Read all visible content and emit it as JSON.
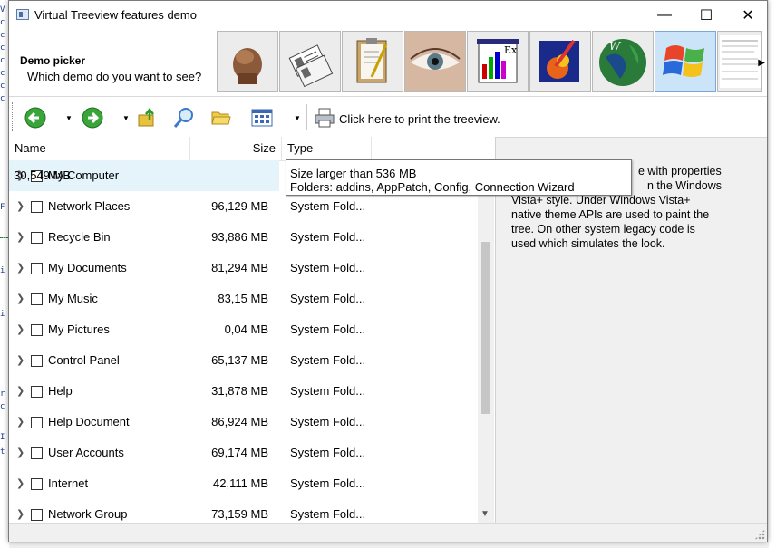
{
  "window": {
    "title": "Virtual Treeview features demo",
    "minimize": "—",
    "maximize": "☐",
    "close": "✕"
  },
  "picker": {
    "title": "Demo picker",
    "subtitle": "Which demo do you want to see?",
    "demos": [
      "speed-demo-icon",
      "properties-icon",
      "clipboard-icon",
      "eye-icon",
      "chart-icon",
      "paint-icon",
      "globe-icon",
      "windows-icon",
      "document-icon"
    ],
    "selected_index": 7
  },
  "toolbar": {
    "print_label": "Click here to print the treeview."
  },
  "tree": {
    "columns": {
      "name": "Name",
      "size": "Size",
      "type": "Type"
    },
    "rows": [
      {
        "name": "My Computer",
        "size": "30,549 MB",
        "type": ""
      },
      {
        "name": "Network Places",
        "size": "96,129 MB",
        "type": "System Fold..."
      },
      {
        "name": "Recycle Bin",
        "size": "93,886 MB",
        "type": "System Fold..."
      },
      {
        "name": "My Documents",
        "size": "81,294 MB",
        "type": "System Fold..."
      },
      {
        "name": "My Music",
        "size": "83,15 MB",
        "type": "System Fold..."
      },
      {
        "name": "My Pictures",
        "size": "0,04 MB",
        "type": "System Fold..."
      },
      {
        "name": "Control Panel",
        "size": "65,137 MB",
        "type": "System Fold..."
      },
      {
        "name": "Help",
        "size": "31,878 MB",
        "type": "System Fold..."
      },
      {
        "name": "Help Document",
        "size": "86,924 MB",
        "type": "System Fold..."
      },
      {
        "name": "User Accounts",
        "size": "69,174 MB",
        "type": "System Fold..."
      },
      {
        "name": "Internet",
        "size": "42,111 MB",
        "type": "System Fold..."
      },
      {
        "name": "Network Group",
        "size": "73,159 MB",
        "type": "System Fold..."
      }
    ]
  },
  "tooltip": {
    "line1": "Size larger than 536 MB",
    "line2": "Folders: addins, AppPatch, Config, Connection Wizard"
  },
  "description": {
    "line1": "e with properties",
    "line2": "n the Windows",
    "line3": "Vista+ style. Under Windows Vista+",
    "line4": "native theme APIs are used to paint the",
    "line5": "tree. On other system legacy code is",
    "line6": "used which simulates the look."
  }
}
